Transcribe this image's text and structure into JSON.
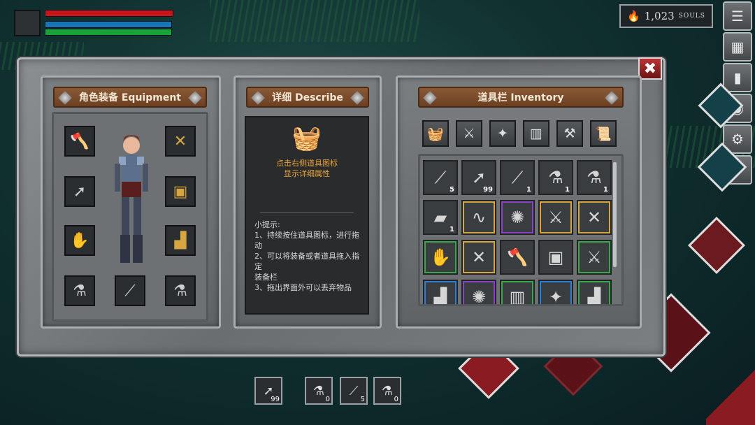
{
  "hud": {
    "bars": [
      {
        "name": "health",
        "fill": 1.0,
        "color": "#c8141b"
      },
      {
        "name": "mana",
        "fill": 1.0,
        "color": "#1676b8"
      },
      {
        "name": "stamina",
        "fill": 1.0,
        "color": "#17a33a"
      }
    ],
    "souls_value": "1,023",
    "souls_label": "SOULS"
  },
  "right_menu": [
    {
      "name": "menu-list-icon",
      "glyph": "☰"
    },
    {
      "name": "map-icon",
      "glyph": "▦"
    },
    {
      "name": "door-icon",
      "glyph": "▮"
    },
    {
      "name": "medal-icon",
      "glyph": "◉"
    },
    {
      "name": "settings-gear-icon",
      "glyph": "⚙"
    },
    {
      "name": "help-icon",
      "glyph": "?"
    }
  ],
  "equipment": {
    "title": "角色装备 Equipment",
    "slots": [
      {
        "name": "weapon-axe-slot",
        "glyph": "🪓",
        "rarity": "gold"
      },
      {
        "name": "armor-shoulder-slot",
        "glyph": "✕",
        "rarity": "gold"
      },
      {
        "name": "arrow-slot",
        "glyph": "➚",
        "rarity": "none"
      },
      {
        "name": "chest-armor-slot",
        "glyph": "▣",
        "rarity": "gold"
      },
      {
        "name": "glove-slot",
        "glyph": "✋",
        "rarity": "gold"
      },
      {
        "name": "boots-slot",
        "glyph": "▟",
        "rarity": "gold"
      },
      {
        "name": "blue-potion-slot",
        "glyph": "⚗",
        "rarity": "none"
      },
      {
        "name": "yellow-vial-slot",
        "glyph": "⟋",
        "rarity": "none"
      },
      {
        "name": "blue-potion-slot-2",
        "glyph": "⚗",
        "rarity": "none"
      }
    ]
  },
  "describe": {
    "title": "详细 Describe",
    "hint_line1": "点击右侧道具图标",
    "hint_line2": "显示详细属性",
    "tips": "小提示:\n1、持续按住道具图标，进行拖动\n2、可以将装备或者道具拖入指定\n装备栏\n3、拖出界面外可以丢弃物品"
  },
  "inventory": {
    "title": "道具栏 Inventory",
    "filters": [
      {
        "name": "filter-basket-icon",
        "glyph": "🧺"
      },
      {
        "name": "filter-weapon-icon",
        "glyph": "⚔"
      },
      {
        "name": "filter-armor-icon",
        "glyph": "✦"
      },
      {
        "name": "filter-map-icon",
        "glyph": "▥"
      },
      {
        "name": "filter-tools-icon",
        "glyph": "⚒"
      },
      {
        "name": "filter-scroll-icon",
        "glyph": "📜"
      }
    ],
    "items": [
      {
        "name": "yellow-vial-item",
        "glyph": "⟋",
        "count": "5",
        "rarity": "none"
      },
      {
        "name": "arrow-item",
        "glyph": "➚",
        "count": "99",
        "rarity": "none"
      },
      {
        "name": "red-vial-item",
        "glyph": "⟋",
        "count": "1",
        "rarity": "none"
      },
      {
        "name": "green-potion-item",
        "glyph": "⚗",
        "count": "1",
        "rarity": "none"
      },
      {
        "name": "green-flask-item",
        "glyph": "⚗",
        "count": "1",
        "rarity": "none"
      },
      {
        "name": "gold-bar-item",
        "glyph": "▰",
        "count": "1",
        "rarity": "none"
      },
      {
        "name": "rope-item",
        "glyph": "∿",
        "count": "",
        "rarity": "gold"
      },
      {
        "name": "spiked-ball-item",
        "glyph": "✺",
        "count": "",
        "rarity": "purple"
      },
      {
        "name": "sword-item",
        "glyph": "⚔",
        "count": "",
        "rarity": "gold"
      },
      {
        "name": "crossed-swords-item",
        "glyph": "✕",
        "count": "",
        "rarity": "gold"
      },
      {
        "name": "gauntlet-item",
        "glyph": "✋",
        "count": "",
        "rarity": "green"
      },
      {
        "name": "crossed-axes-item",
        "glyph": "✕",
        "count": "",
        "rarity": "gold"
      },
      {
        "name": "axe-item",
        "glyph": "🪓",
        "count": "",
        "rarity": "none"
      },
      {
        "name": "armor-item",
        "glyph": "▣",
        "count": "",
        "rarity": "none"
      },
      {
        "name": "sword-green-item",
        "glyph": "⚔",
        "count": "",
        "rarity": "green"
      },
      {
        "name": "boots-item",
        "glyph": "▟",
        "count": "",
        "rarity": "blue"
      },
      {
        "name": "spiked-item",
        "glyph": "✺",
        "count": "",
        "rarity": "purple"
      },
      {
        "name": "scroll-item",
        "glyph": "▥",
        "count": "",
        "rarity": "green"
      },
      {
        "name": "mace-item",
        "glyph": "✦",
        "count": "",
        "rarity": "blue"
      },
      {
        "name": "leg-armor-item",
        "glyph": "▟",
        "count": "",
        "rarity": "green"
      }
    ]
  },
  "quickbar": [
    {
      "name": "quick-arrow-slot",
      "glyph": "➚",
      "count": "99"
    },
    {
      "name": "quick-blue-potion-slot",
      "glyph": "⚗",
      "count": "0"
    },
    {
      "name": "quick-yellow-vial-slot",
      "glyph": "⟋",
      "count": "5"
    },
    {
      "name": "quick-blue-potion-slot-2",
      "glyph": "⚗",
      "count": "0"
    }
  ],
  "close_glyph": "✖",
  "souls_glyph": "🔥",
  "basket_glyph": "🧺"
}
